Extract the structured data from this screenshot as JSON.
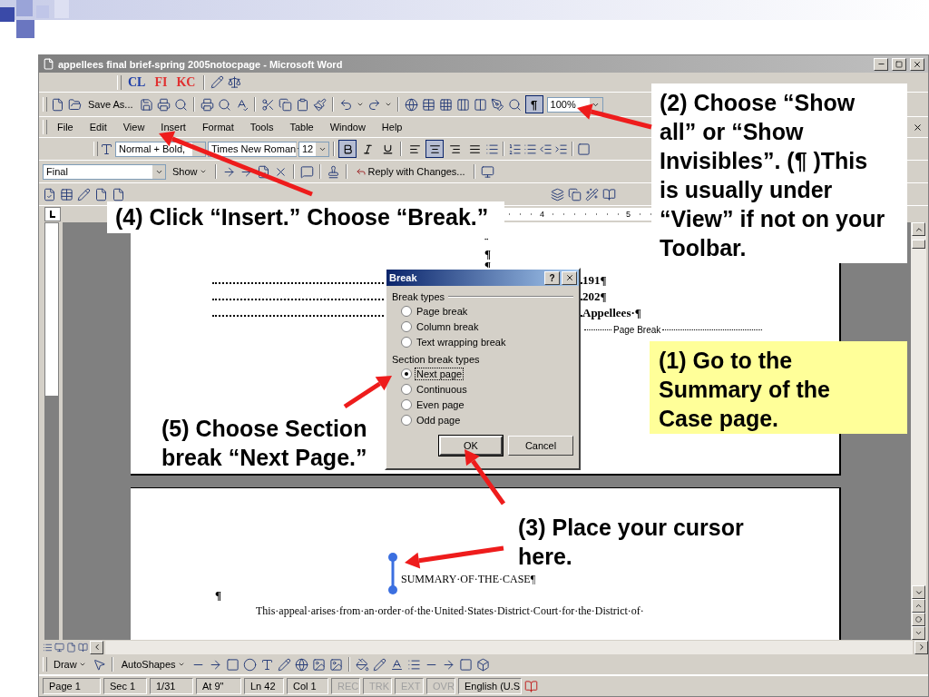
{
  "window": {
    "title": "appellees final brief-spring 2005notocpage - Microsoft Word"
  },
  "custom_toolbar": [
    {
      "label": "CL",
      "color": "#1f3fa8"
    },
    {
      "label": "FI",
      "color": "#e03030"
    },
    {
      "label": "KC",
      "color": "#e03030"
    }
  ],
  "standard_toolbar": {
    "save_as": "Save As...",
    "show_all": "¶",
    "show_all_selected": true,
    "zoom": "100%"
  },
  "menu": [
    "File",
    "Edit",
    "View",
    "Insert",
    "Format",
    "Tools",
    "Table",
    "Window",
    "Help"
  ],
  "formatting_toolbar": {
    "style": "Normal + Bold,",
    "font": "Times New Roman",
    "size": "12",
    "bold": true,
    "italic": false,
    "underline": false,
    "align_center": true
  },
  "reviewing_toolbar": {
    "display": "Final",
    "show": "Show",
    "reply": "Reply with Changes..."
  },
  "ruler": {
    "numbers": [
      "4",
      "5"
    ]
  },
  "page_1": {
    "marks": [
      "¨",
      "¶",
      "¶"
    ],
    "toc_entries": [
      "191¶",
      "202¶",
      "Appellees·¶"
    ],
    "page_break": "Page Break"
  },
  "page_2": {
    "heading": "SUMMARY·OF·THE·CASE¶",
    "empty_paragraph": "¶",
    "body": "This·appeal·arises·from·an·order·of·the·United·States·District·Court·for·the·District·of·"
  },
  "dialog": {
    "title": "Break",
    "help": "?",
    "groups": [
      {
        "label": "Break types",
        "options": [
          {
            "label": "Page break",
            "selected": false
          },
          {
            "label": "Column break",
            "selected": false
          },
          {
            "label": "Text wrapping break",
            "selected": false
          }
        ]
      },
      {
        "label": "Section break types",
        "options": [
          {
            "label": "Next page",
            "selected": true
          },
          {
            "label": "Continuous",
            "selected": false
          },
          {
            "label": "Even page",
            "selected": false
          },
          {
            "label": "Odd page",
            "selected": false
          }
        ]
      }
    ],
    "buttons": [
      "OK",
      "Cancel"
    ]
  },
  "drawing_toolbar": {
    "draw": "Draw",
    "autoshapes": "AutoShapes"
  },
  "status_bar": [
    {
      "text": "Page 1",
      "disabled": false
    },
    {
      "text": "Sec 1",
      "disabled": false
    },
    {
      "text": "1/31",
      "disabled": false
    },
    {
      "text": "At 9\"",
      "disabled": false
    },
    {
      "text": "Ln 42",
      "disabled": false
    },
    {
      "text": "Col 1",
      "disabled": false
    },
    {
      "text": "REC",
      "disabled": true
    },
    {
      "text": "TRK",
      "disabled": true
    },
    {
      "text": "EXT",
      "disabled": true
    },
    {
      "text": "OVR",
      "disabled": true
    },
    {
      "text": "English (U.S",
      "disabled": false
    }
  ],
  "callouts": [
    {
      "text": "(2) Choose “Show all” or “Show Invisibles”. (¶ )This is usually under “View” if not on your Toolbar.",
      "kind": "white"
    },
    {
      "text": "(4) Click “Insert.” Choose “Break.”",
      "kind": "white"
    },
    {
      "text": "(1) Go to the Summary of the Case page.",
      "kind": "yellow"
    },
    {
      "text": "(5) Choose Section break “Next Page.”",
      "kind": "plain"
    },
    {
      "text": "(3) Place your cursor here.",
      "kind": "plain"
    }
  ]
}
